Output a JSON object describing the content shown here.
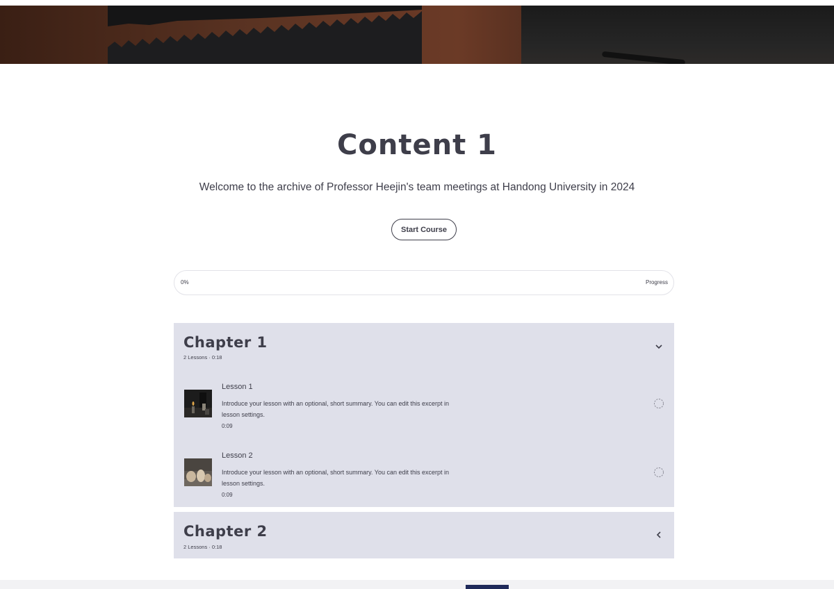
{
  "hero": {
    "image": "desk-with-acoustic-foam-photo"
  },
  "course": {
    "title": "Content 1",
    "subtitle": "Welcome to the archive of Professor Heejin's team meetings at Handong University in 2024",
    "start_label": "Start Course"
  },
  "progress": {
    "percent_label": "0%",
    "label": "Progress",
    "value": 0
  },
  "chapters": [
    {
      "title": "Chapter 1",
      "meta": "2 Lessons · 0:18",
      "expanded": true,
      "chevron_icon": "chevron-down-icon",
      "lessons": [
        {
          "title": "Lesson 1",
          "description": "Introduce your lesson with an optional, short summary. You can edit this excerpt in lesson settings.",
          "duration": "0:09",
          "thumbnail": "candles-thumbnail"
        },
        {
          "title": "Lesson 2",
          "description": "Introduce your lesson with an optional, short summary. You can edit this excerpt in lesson settings.",
          "duration": "0:09",
          "thumbnail": "stones-thumbnail"
        }
      ]
    },
    {
      "title": "Chapter 2",
      "meta": "2 Lessons · 0:18",
      "expanded": false,
      "chevron_icon": "chevron-left-icon"
    }
  ],
  "colors": {
    "text": "#3e3e4a",
    "chapter_bg": "#dfe0ea",
    "footer_accent": "#1f2a5a"
  }
}
